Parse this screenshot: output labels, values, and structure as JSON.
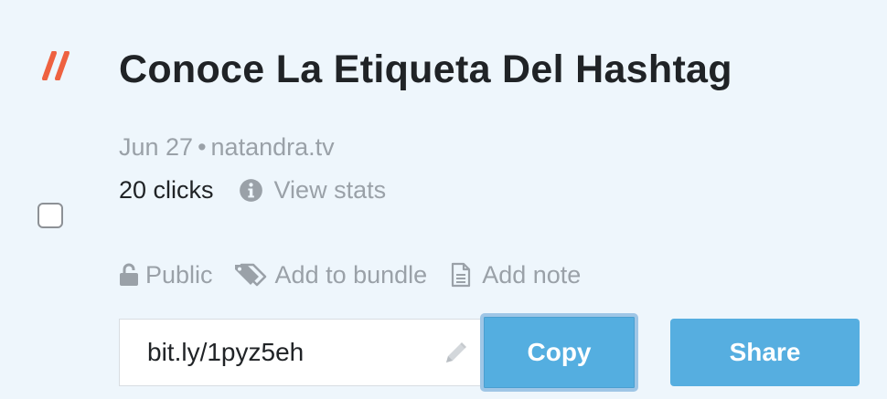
{
  "colors": {
    "card_background": "#eef6fc",
    "brand_accent": "#ee6140",
    "title_text": "#202326",
    "muted_text": "#9aa1a8",
    "button_blue": "#56aee0",
    "button_text": "#ffffff"
  },
  "link": {
    "title": "Conoce La Etiqueta Del Hashtag",
    "date": "Jun 27",
    "separator": "•",
    "source_domain": "natandra.tv",
    "clicks": "20 clicks",
    "view_stats_label": "View stats",
    "short_url": "bit.ly/1pyz5eh"
  },
  "actions": {
    "privacy_label": "Public",
    "bundle_label": "Add to bundle",
    "note_label": "Add note"
  },
  "buttons": {
    "copy_label": "Copy",
    "share_label": "Share"
  },
  "icons": {
    "brand": "double-slash-icon",
    "info": "info-circle-icon",
    "privacy": "unlock-icon",
    "bundle": "tag-icon",
    "note": "document-icon",
    "edit": "pencil-icon"
  }
}
